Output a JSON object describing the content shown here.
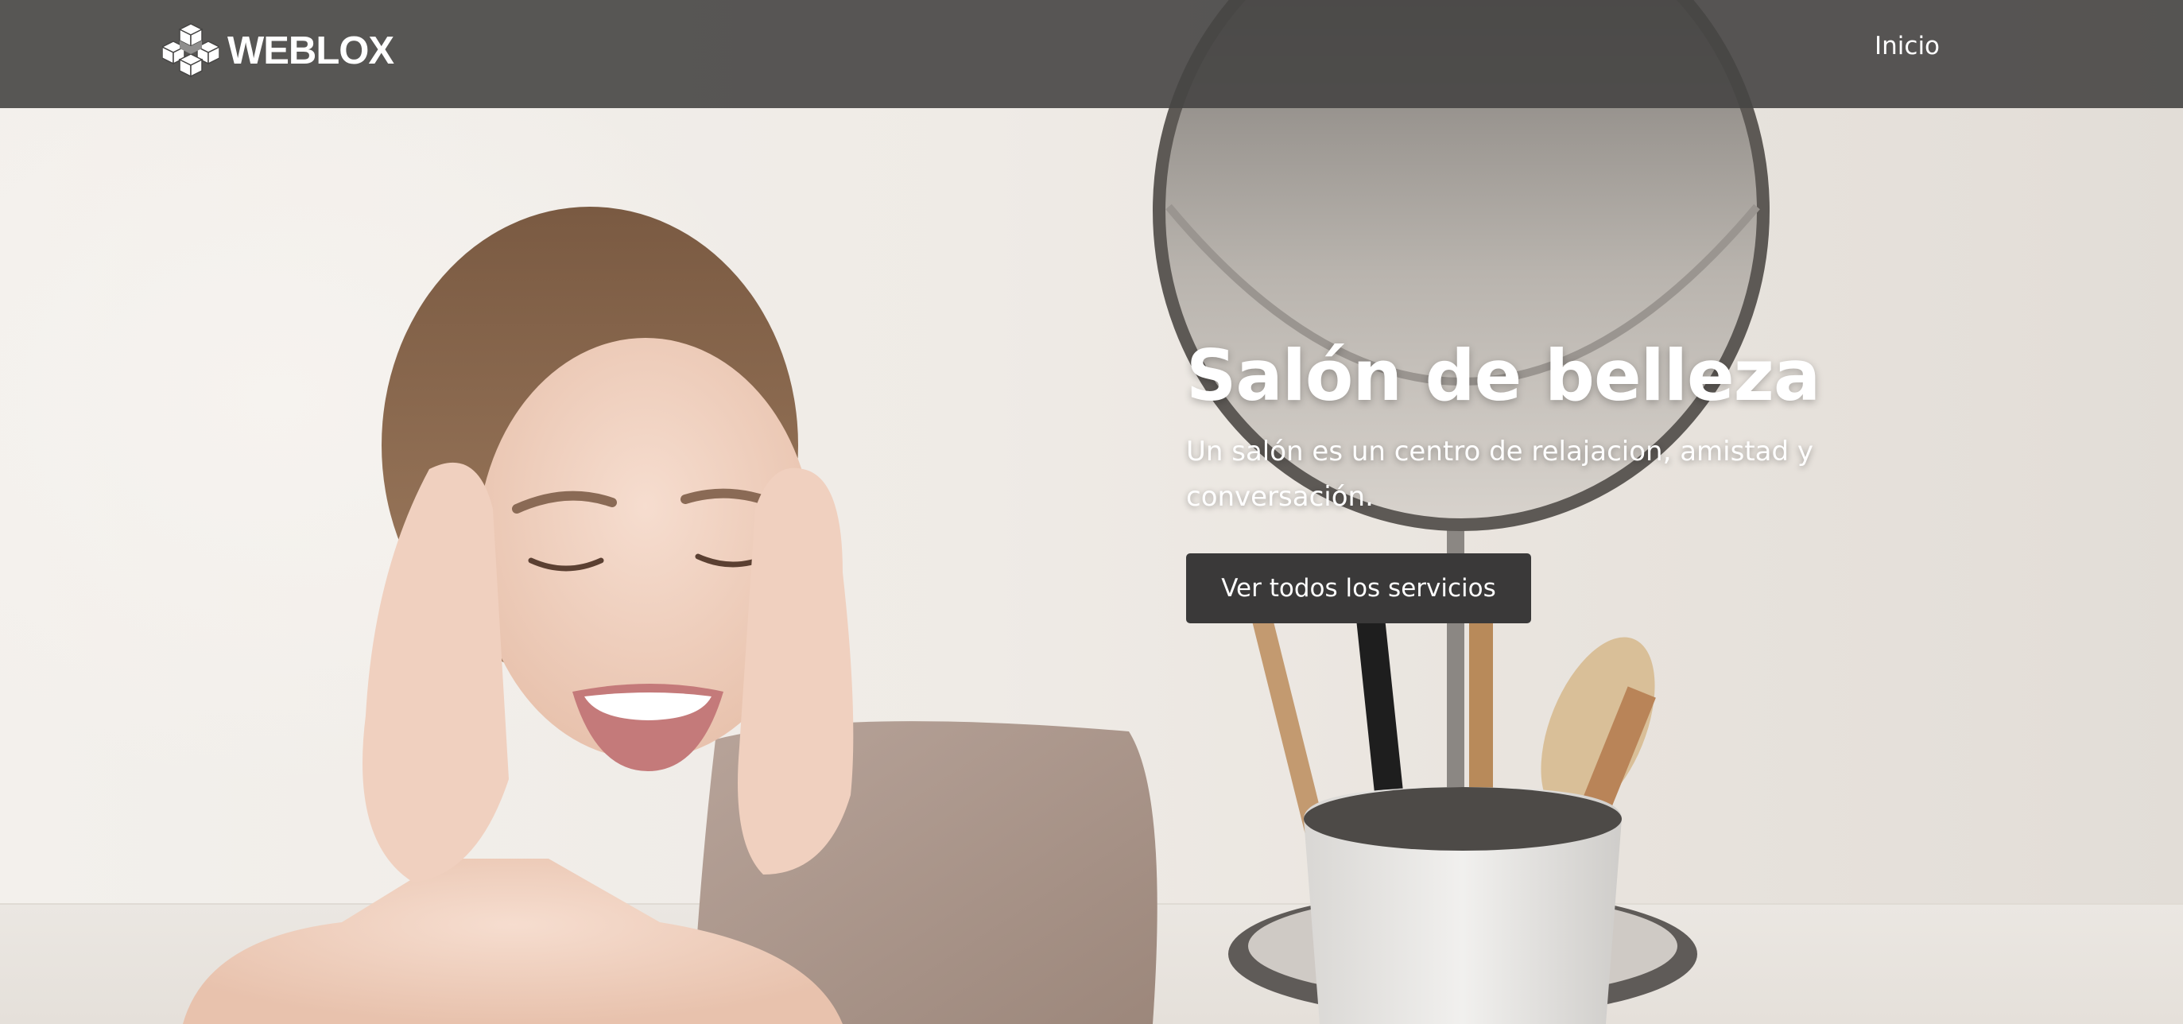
{
  "brand": {
    "name": "WEBLOX"
  },
  "nav": {
    "items": [
      {
        "label": "Inicio"
      }
    ]
  },
  "hero": {
    "title": "Salón de belleza",
    "subtitle": "Un salón es un centro de relajacion, amistad y conversación.",
    "cta_label": "Ver todos los servicios"
  },
  "colors": {
    "header_bg": "#464544",
    "button_bg": "#3a3939",
    "text_light": "#ffffff"
  },
  "icons": {
    "logo": "cube-logo-icon"
  }
}
